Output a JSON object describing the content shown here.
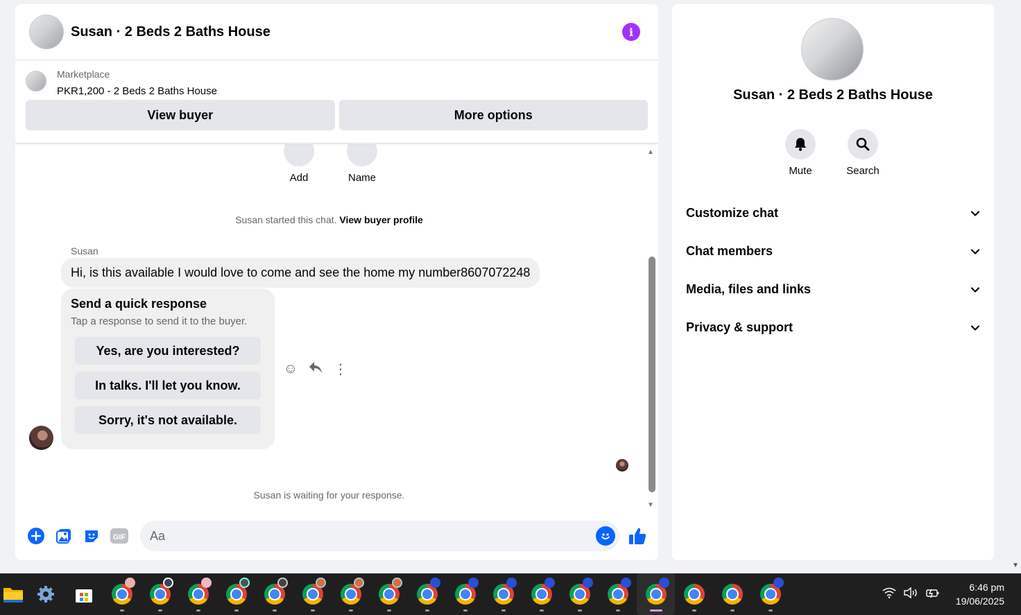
{
  "header": {
    "title": "Susan · 2 Beds 2 Baths House",
    "info_icon": "info-icon"
  },
  "listing": {
    "source": "Marketplace",
    "name": "PKR1,200 - 2 Beds 2 Baths House",
    "view_buyer": "View buyer",
    "more_options": "More options"
  },
  "top_actions": {
    "add": "Add",
    "name": "Name"
  },
  "messages": {
    "started_prefix": "Susan started this chat.",
    "started_link": "View buyer profile",
    "sender": "Susan",
    "text": "Hi, is this available I would love to come and see the home my number8607072248",
    "quick": {
      "title": "Send a quick response",
      "subtitle": "Tap a response to send it to the buyer.",
      "options": [
        "Yes, are you interested?",
        "In talks. I'll let you know.",
        "Sorry, it's not available."
      ]
    },
    "waiting": "Susan is waiting for your response."
  },
  "composer": {
    "placeholder": "Aa",
    "accent": "#0866ff"
  },
  "details": {
    "title": "Susan · 2 Beds 2 Baths House",
    "mute": "Mute",
    "search": "Search",
    "sections": [
      "Customize chat",
      "Chat members",
      "Media, files and links",
      "Privacy & support"
    ]
  },
  "taskbar": {
    "time": "6:46 pm",
    "date": "19/06/2025"
  },
  "colors": {
    "info": "#a033ff",
    "accent": "#0866ff"
  }
}
